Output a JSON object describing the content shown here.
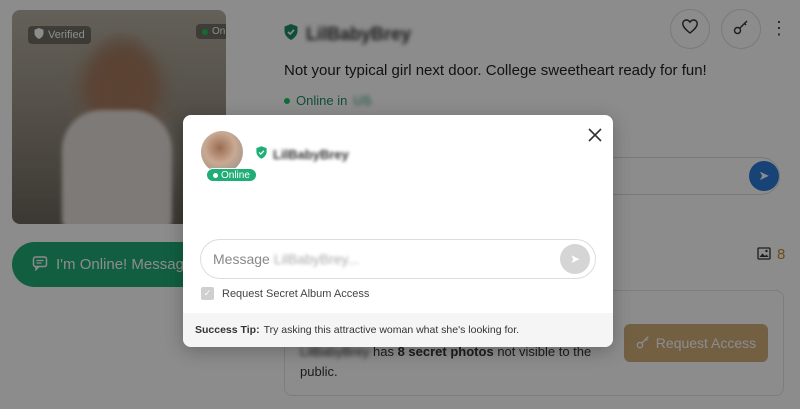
{
  "profile": {
    "username": "LilBabyBrey",
    "verified_label": "Verified",
    "online_label": "Online",
    "tagline": "Not your typical girl next door. College sweetheart ready for fun!",
    "online_in_label": "Online in",
    "online_location": "US",
    "message_button_label": "I'm Online! Message",
    "photo_count": "8",
    "secret_text_user": "LilBabyBrey",
    "secret_text_has": "has",
    "secret_text_count": "8 secret photos",
    "secret_text_rest": "not visible to the public.",
    "request_access_label": "Request Access"
  },
  "modal": {
    "username": "LilBabyBrey",
    "online_badge": "Online",
    "message_placeholder_prefix": "Message",
    "message_placeholder_user": "LilBabyBrey...",
    "checkbox_label": "Request Secret Album Access",
    "tip_label": "Success Tip:",
    "tip_text": "Try asking this attractive woman what she's looking for."
  },
  "colors": {
    "accent_green": "#1fae76",
    "send_blue": "#2b7bd8",
    "gold": "#d2b07a"
  },
  "icons": [
    "shield-check-icon",
    "heart-icon",
    "key-icon",
    "more-vertical-icon",
    "chat-icon",
    "send-icon",
    "image-icon",
    "close-icon",
    "checkbox-icon"
  ]
}
